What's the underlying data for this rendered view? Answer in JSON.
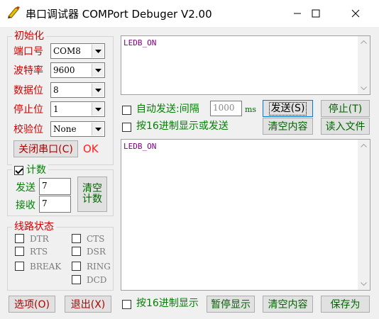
{
  "window": {
    "title": "串口调试器 COMPort Debuger V2.00",
    "icon": "pencil-icon"
  },
  "init_group": {
    "legend": "初始化",
    "port_label": "端口号",
    "port_value": "COM8",
    "baud_label": "波特率",
    "baud_value": "9600",
    "data_label": "数据位",
    "data_value": "8",
    "stop_label": "停止位",
    "stop_value": "1",
    "parity_label": "校验位",
    "parity_value": "None",
    "close_port_label": "关闭串口(C)",
    "status_text": "OK"
  },
  "count_group": {
    "legend": "计数",
    "checked": true,
    "sent_label": "发送",
    "sent_value": "7",
    "recv_label": "接收",
    "recv_value": "7",
    "clear_count_label": "清空计数"
  },
  "line_status": {
    "legend": "线路状态",
    "signals": [
      "DTR",
      "CTS",
      "RTS",
      "DSR",
      "BREAK",
      "RING",
      "DCD"
    ]
  },
  "send_area": {
    "text": "LEDB_ON",
    "auto_send_label": "自动发送:间隔",
    "interval_value": "1000",
    "interval_unit": "ms",
    "send_label": "发送(S)",
    "stop_label": "停止(T)",
    "hex_send_label": "按16进制显示或发送",
    "clear_label": "清空内容",
    "read_file_label": "读入文件"
  },
  "recv_area": {
    "text": "LEDB_ON"
  },
  "bottom_bar": {
    "options_label": "选项(O)",
    "exit_label": "退出(X)",
    "hex_display_label": "按16进制显示",
    "pause_label": "暂停显示",
    "clear_label": "清空内容",
    "save_as_label": "保存为"
  }
}
